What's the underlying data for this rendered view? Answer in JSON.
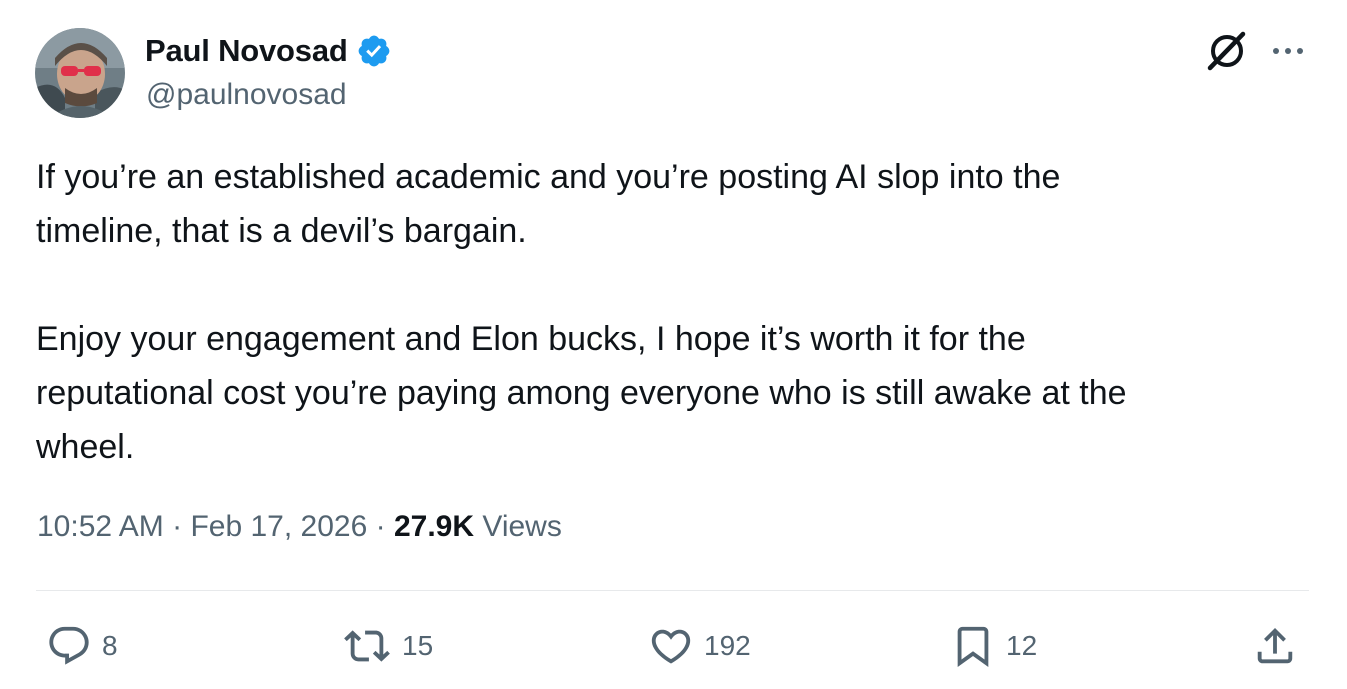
{
  "author": {
    "display_name": "Paul Novosad",
    "handle": "@paulnovosad",
    "verified": true
  },
  "tweet": {
    "paragraphs": [
      "If you’re an established academic and you’re posting AI slop into the\ntimeline, that is a devil’s bargain.",
      "Enjoy your engagement and Elon bucks, I hope it’s worth it for the\nreputational cost you’re paying among everyone who is still awake at the\nwheel."
    ]
  },
  "meta": {
    "time": "10:52 AM",
    "separator": "·",
    "date": "Feb 17, 2026",
    "views_count": "27.9K",
    "views_label": "Views"
  },
  "actions": {
    "reply_count": "8",
    "retweet_count": "15",
    "like_count": "192",
    "bookmark_count": "12"
  },
  "icons": {
    "header_right": [
      "grok-icon",
      "more-icon"
    ],
    "actions": [
      "reply-icon",
      "retweet-icon",
      "like-icon",
      "bookmark-icon",
      "share-icon"
    ]
  },
  "colors": {
    "text_primary": "#0f1419",
    "text_secondary": "#536471",
    "verified_blue": "#1d9bf0",
    "divider": "#e7e9eb"
  }
}
